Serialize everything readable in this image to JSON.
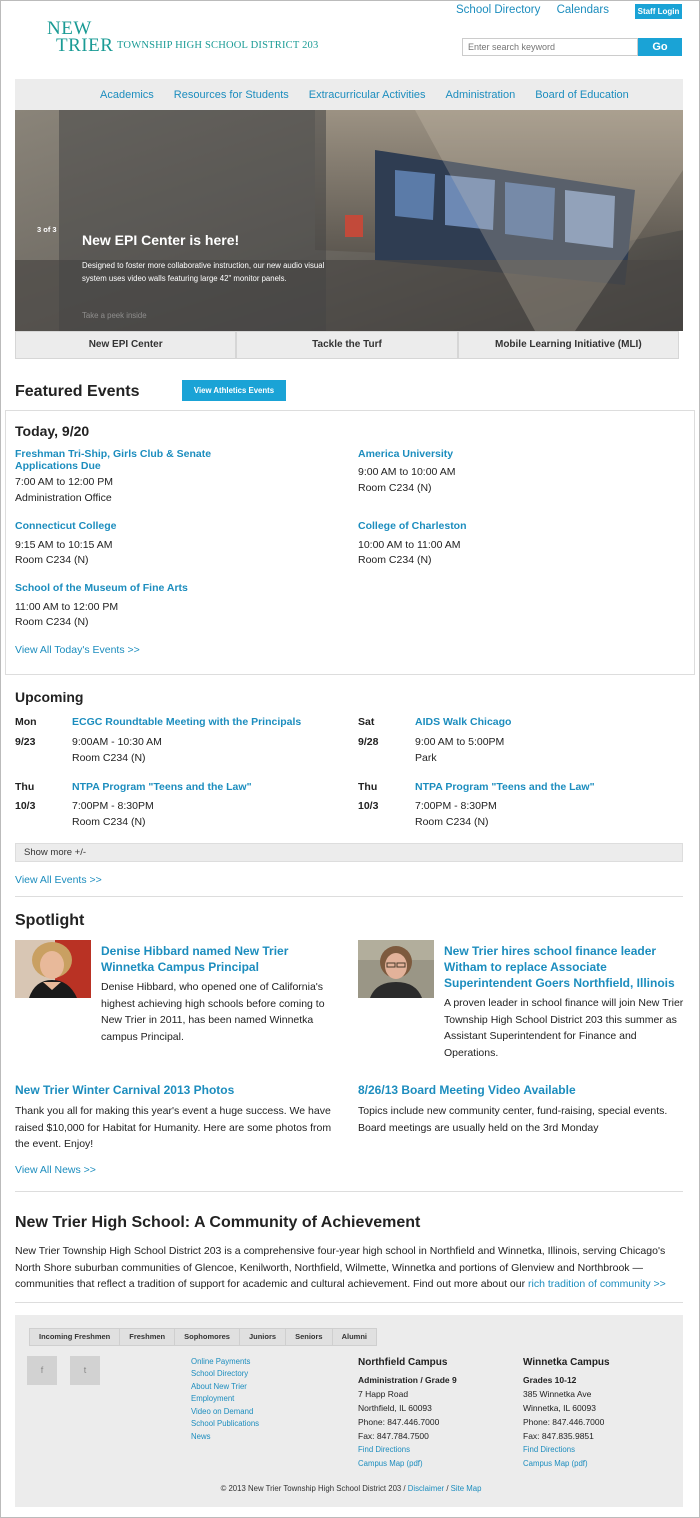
{
  "header": {
    "logo_new": "NEW",
    "logo_trier": "TRIER",
    "logo_district": "TOWNSHIP HIGH SCHOOL DISTRICT 203",
    "top_links": [
      "School Directory",
      "Calendars"
    ],
    "staff_login": "Staff Login",
    "search_placeholder": "Enter search keyword",
    "search_button": "Go"
  },
  "nav": [
    "Academics",
    "Resources for Students",
    "Extracurricular Activities",
    "Administration",
    "Board of Education"
  ],
  "hero": {
    "counter": "3 of 3",
    "title": "New EPI Center is here!",
    "description": "Designed to foster more collaborative instruction, our new audio visual system uses video walls featuring large 42\" monitor panels.",
    "link": "Take a peek inside"
  },
  "slide_tabs": [
    "New EPI Center",
    "Tackle the Turf",
    "Mobile Learning Initiative (MLI)"
  ],
  "featured": {
    "title": "Featured Events",
    "athletics_button": "View Athletics Events",
    "today_title": "Today, 9/20",
    "events": [
      {
        "title": "Freshman Tri-Ship, Girls Club & Senate Applications Due",
        "time": "7:00 AM to 12:00 PM",
        "place": "Administration Office"
      },
      {
        "title": "America University",
        "time": "9:00 AM to 10:00 AM",
        "place": "Room C234 (N)"
      },
      {
        "title": "Connecticut College",
        "time": "9:15 AM to 10:15 AM",
        "place": "Room C234 (N)"
      },
      {
        "title": "College of Charleston",
        "time": "10:00 AM to 11:00 AM",
        "place": "Room C234 (N)"
      },
      {
        "title": "School of the Museum of Fine Arts",
        "time": "11:00 AM to 12:00 PM",
        "place": "Room C234 (N)"
      }
    ],
    "view_all_today": "View All Today's Events >>"
  },
  "upcoming": {
    "title": "Upcoming",
    "events": [
      {
        "day": "Mon",
        "date": "9/23",
        "title": "ECGC Roundtable Meeting with the Principals",
        "time": "9:00AM - 10:30 AM",
        "place": "Room C234 (N)"
      },
      {
        "day": "Sat",
        "date": "9/28",
        "title": "AIDS Walk Chicago",
        "time": "9:00 AM to 5:00PM",
        "place": "Park"
      },
      {
        "day": "Thu",
        "date": "10/3",
        "title": "NTPA Program \"Teens and the Law\"",
        "time": "7:00PM - 8:30PM",
        "place": "Room C234 (N)"
      },
      {
        "day": "Thu",
        "date": "10/3",
        "title": "NTPA Program \"Teens and the Law\"",
        "time": "7:00PM - 8:30PM",
        "place": "Room C234 (N)"
      }
    ],
    "show_more": "Show more +/-",
    "view_all": "View All Events >>"
  },
  "spotlight": {
    "title": "Spotlight",
    "items": [
      {
        "title": "Denise Hibbard named New Trier Winnetka Campus Principal",
        "text": "Denise Hibbard, who opened one of California's highest achieving high schools before coming to New Trier in 2011, has been named Winnetka campus Principal."
      },
      {
        "title": "New Trier hires school finance leader Witham to replace Associate Superintendent Goers Northfield, Illinois",
        "text": "A proven leader in school finance will join New Trier Township High School District 203 this summer as Assistant Superintendent for Finance and Operations."
      },
      {
        "title": "New Trier Winter Carnival 2013 Photos",
        "text": "Thank you all for making this year's event a huge success. We have raised $10,000 for Habitat for Humanity. Here are some photos from the event. Enjoy!"
      },
      {
        "title": "8/26/13 Board Meeting Video Available",
        "text": "Topics include new community center, fund-raising, special events. Board meetings are usually held on the 3rd Monday"
      }
    ],
    "view_all": "View All News >>"
  },
  "community": {
    "title": "New Trier High School: A Community of Achievement",
    "text": "New Trier Township High School District 203 is a comprehensive four-year high school in Northfield and Winnetka, Illinois, serving Chicago's North Shore suburban communities of Glencoe, Kenilworth, Northfield, Wilmette, Winnetka and portions of Glenview and Northbrook — communities that reflect a tradition of support for academic and cultural achievement. Find out more about our",
    "link": "rich tradition of community >>"
  },
  "footer": {
    "tabs": [
      "Incoming Freshmen",
      "Freshmen",
      "Sophomores",
      "Juniors",
      "Seniors",
      "Alumni"
    ],
    "social": [
      "f",
      "t"
    ],
    "links": [
      "Online Payments",
      "School Directory",
      "About New Trier",
      "Employment",
      "Video on Demand",
      "School Publications",
      "News"
    ],
    "northfield": {
      "title": "Northfield Campus",
      "sub": "Administration / Grade 9",
      "lines": [
        "7 Happ Road",
        "Northfield, IL 60093",
        "Phone: 847.446.7000",
        "Fax: 847.784.7500"
      ],
      "links": [
        "Find Directions",
        "Campus Map (pdf)"
      ]
    },
    "winnetka": {
      "title": "Winnetka Campus",
      "sub": "Grades 10-12",
      "lines": [
        "385 Winnetka Ave",
        "Winnetka, IL 60093",
        "Phone: 847.446.7000",
        "Fax: 847.835.9851"
      ],
      "links": [
        "Find Directions",
        "Campus Map (pdf)"
      ]
    },
    "copyright": "© 2013 New Trier Township High School District 203 /",
    "disclaimer": "Disclaimer",
    "slash": "/",
    "sitemap": "Site Map"
  },
  "colors": {
    "accent": "#1aa3d6",
    "link": "#1c8dbe",
    "logo": "#1a9b95",
    "panel": "#ececec"
  }
}
